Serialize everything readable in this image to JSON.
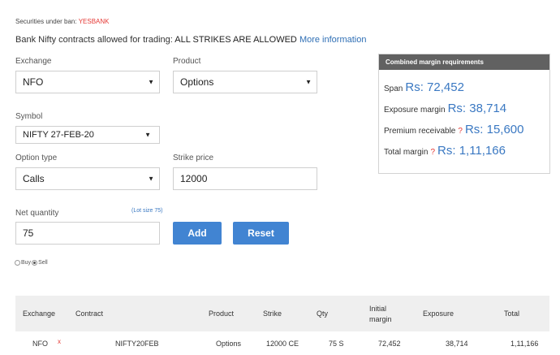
{
  "ban": {
    "label": "Securities under ban:",
    "symbol": "YESBANK"
  },
  "banknifty": {
    "prefix": "Bank Nifty contracts allowed for trading:",
    "status": "ALL STRIKES ARE ALLOWED",
    "link": "More information"
  },
  "form": {
    "exchange": {
      "label": "Exchange",
      "value": "NFO"
    },
    "product": {
      "label": "Product",
      "value": "Options"
    },
    "symbol": {
      "label": "Symbol",
      "value": "NIFTY 27-FEB-20"
    },
    "option_type": {
      "label": "Option type",
      "value": "Calls"
    },
    "strike_price": {
      "label": "Strike price",
      "value": "12000"
    },
    "net_quantity": {
      "label": "Net quantity",
      "value": "75",
      "lot_size": "(Lot size 75)"
    },
    "add_label": "Add",
    "reset_label": "Reset",
    "buy_label": "Buy",
    "sell_label": "Sell",
    "side_selected": "Sell"
  },
  "margin": {
    "title": "Combined margin requirements",
    "span_label": "Span",
    "span_value": "Rs: 72,452",
    "exposure_label": "Exposure margin",
    "exposure_value": "Rs: 38,714",
    "premium_label": "Premium receivable",
    "premium_value": "Rs: 15,600",
    "total_label": "Total margin",
    "total_value": "Rs: 1,11,166",
    "help_glyph": "?"
  },
  "table": {
    "headers": {
      "exchange": "Exchange",
      "contract": "Contract",
      "product": "Product",
      "strike": "Strike",
      "qty": "Qty",
      "initial_1": "Initial",
      "initial_2": "margin",
      "exposure": "Exposure",
      "total": "Total"
    },
    "rows": [
      {
        "exchange": "NFO",
        "remove": "x",
        "contract": "NIFTY20FEB",
        "product": "Options",
        "strike": "12000 CE",
        "qty": "75 S",
        "initial": "72,452",
        "exposure": "38,714",
        "total": "1,11,166"
      }
    ]
  },
  "colors": {
    "accent": "#4184d2",
    "link": "#2f6fb5",
    "danger": "#e53935",
    "panel_header": "#616161",
    "table_header_bg": "#efefef"
  }
}
